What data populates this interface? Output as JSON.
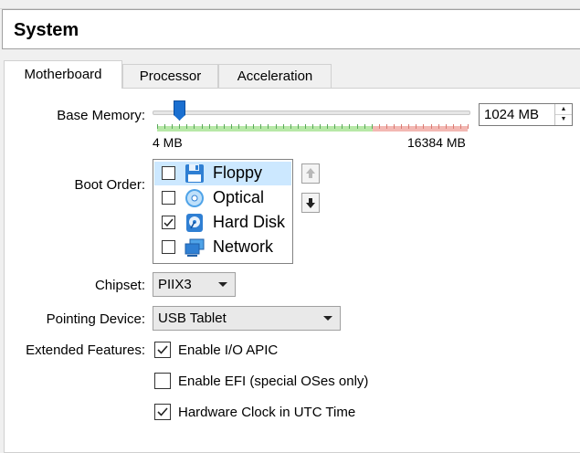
{
  "header": {
    "title": "System"
  },
  "tabs": [
    {
      "label": "Motherboard",
      "active": true
    },
    {
      "label": "Processor",
      "active": false
    },
    {
      "label": "Acceleration",
      "active": false
    }
  ],
  "motherboard": {
    "base_memory": {
      "label": "Base Memory:",
      "value": "1024 MB",
      "value_mb": 1024,
      "min_label": "4 MB",
      "max_label": "16384 MB"
    },
    "boot_order": {
      "label": "Boot Order:",
      "items": [
        {
          "label": "Floppy",
          "checked": false,
          "icon": "floppy-icon",
          "selected": true
        },
        {
          "label": "Optical",
          "checked": false,
          "icon": "optical-disc-icon",
          "selected": false
        },
        {
          "label": "Hard Disk",
          "checked": true,
          "icon": "hard-disk-icon",
          "selected": false
        },
        {
          "label": "Network",
          "checked": false,
          "icon": "network-icon",
          "selected": false
        }
      ]
    },
    "chipset": {
      "label": "Chipset:",
      "value": "PIIX3"
    },
    "pointing_device": {
      "label": "Pointing Device:",
      "value": "USB Tablet"
    },
    "extended_features": {
      "label": "Extended Features:",
      "options": [
        {
          "label": "Enable I/O APIC",
          "checked": true
        },
        {
          "label": "Enable EFI (special OSes only)",
          "checked": false
        },
        {
          "label": "Hardware Clock in UTC Time",
          "checked": true
        }
      ]
    }
  },
  "colors": {
    "accent": "#1a6fd0",
    "selection": "#cce8ff",
    "slider_safe": "#b7e8a7",
    "slider_danger": "#f3b8b3"
  }
}
